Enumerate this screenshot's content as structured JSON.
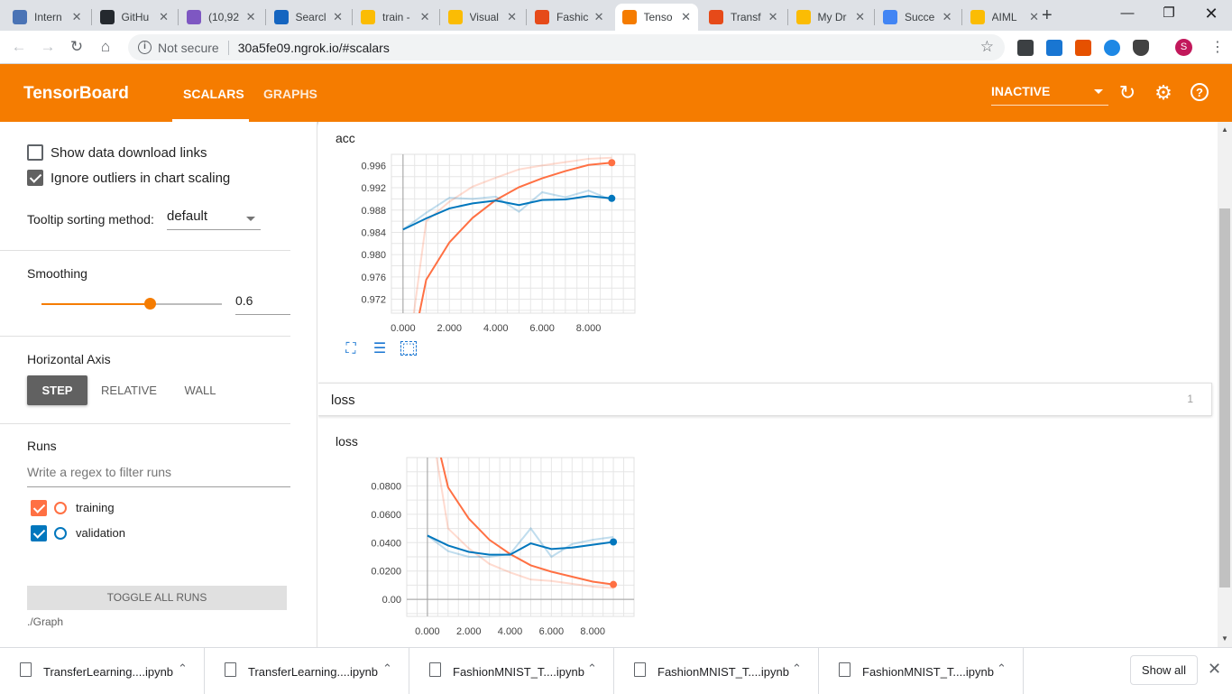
{
  "browser": {
    "tabs": [
      {
        "title": "Intern",
        "color": "#4a73b5"
      },
      {
        "title": "GitHu",
        "color": "#24292e"
      },
      {
        "title": "(10,92",
        "color": "#7e57c2"
      },
      {
        "title": "Searcl",
        "color": "#1565c0"
      },
      {
        "title": "train -",
        "color": "#fbbc04"
      },
      {
        "title": "Visual",
        "color": "#fbbc04"
      },
      {
        "title": "Fashic",
        "color": "#e64a19"
      },
      {
        "title": "Tenso",
        "color": "#f57c00"
      },
      {
        "title": "Transf",
        "color": "#e64a19"
      },
      {
        "title": "My Dr",
        "color": "#fbbc04"
      },
      {
        "title": "Succe",
        "color": "#4285f4"
      },
      {
        "title": "AIML",
        "color": "#fbbc04"
      }
    ],
    "active_tab_index": 7,
    "address": {
      "security": "Not secure",
      "url": "30a5fe09.ngrok.io/#scalars"
    },
    "profile_initial": "S"
  },
  "header": {
    "title": "TensorBoard",
    "tabs": [
      "SCALARS",
      "GRAPHS"
    ],
    "active_tab": "SCALARS",
    "run_state": "INACTIVE",
    "accent": "#f57c00"
  },
  "sidebar": {
    "show_download_links": {
      "label": "Show data download links",
      "checked": false
    },
    "ignore_outliers": {
      "label": "Ignore outliers in chart scaling",
      "checked": true
    },
    "tooltip_label": "Tooltip sorting method:",
    "tooltip_value": "default",
    "smoothing_label": "Smoothing",
    "smoothing_value": "0.6",
    "horizontal_axis_label": "Horizontal Axis",
    "axis_options": [
      "STEP",
      "RELATIVE",
      "WALL"
    ],
    "axis_selected": "STEP",
    "runs_label": "Runs",
    "regex_placeholder": "Write a regex to filter runs",
    "runs": [
      {
        "name": "training",
        "color": "#ff7043",
        "checked": true
      },
      {
        "name": "validation",
        "color": "#0277bd",
        "checked": true
      }
    ],
    "toggle_label": "TOGGLE ALL RUNS",
    "log_dir": "./Graph"
  },
  "main": {
    "loss_category": {
      "name": "loss",
      "count": "1"
    }
  },
  "chart_data": [
    {
      "type": "line",
      "title": "acc",
      "x": [
        0,
        1,
        2,
        3,
        4,
        5,
        6,
        7,
        8,
        9
      ],
      "xticks": [
        "0.000",
        "2.000",
        "4.000",
        "6.000",
        "8.000"
      ],
      "yticks": [
        "0.972",
        "0.976",
        "0.980",
        "0.984",
        "0.988",
        "0.992",
        "0.996"
      ],
      "xlim": [
        -0.5,
        10
      ],
      "ylim": [
        0.9695,
        0.998
      ],
      "series": [
        {
          "name": "training",
          "color": "#ff7043",
          "raw": [
            0.955,
            0.986,
            0.9895,
            0.9922,
            0.9938,
            0.9953,
            0.996,
            0.9966,
            0.9972,
            0.9974
          ],
          "smoothed": [
            0.955,
            0.9755,
            0.9822,
            0.9866,
            0.9898,
            0.9921,
            0.9937,
            0.995,
            0.9961,
            0.9965
          ]
        },
        {
          "name": "validation",
          "color": "#0277bd",
          "raw": [
            0.9845,
            0.9875,
            0.9902,
            0.99,
            0.9904,
            0.9877,
            0.9912,
            0.9903,
            0.9915,
            0.9898
          ],
          "smoothed": [
            0.9845,
            0.9865,
            0.9883,
            0.9892,
            0.9897,
            0.9889,
            0.9898,
            0.9899,
            0.9905,
            0.9901
          ]
        }
      ]
    },
    {
      "type": "line",
      "title": "loss",
      "x": [
        0,
        1,
        2,
        3,
        4,
        5,
        6,
        7,
        8,
        9
      ],
      "xticks": [
        "0.000",
        "2.000",
        "4.000",
        "6.000",
        "8.000"
      ],
      "yticks": [
        "0.00",
        "0.0200",
        "0.0400",
        "0.0600",
        "0.0800"
      ],
      "xlim": [
        -1,
        10
      ],
      "ylim": [
        -0.012,
        0.1
      ],
      "series": [
        {
          "name": "training",
          "color": "#ff7043",
          "raw": [
            0.14,
            0.05,
            0.036,
            0.025,
            0.019,
            0.014,
            0.013,
            0.011,
            0.009,
            0.008
          ],
          "smoothed": [
            0.14,
            0.079,
            0.057,
            0.042,
            0.032,
            0.024,
            0.0195,
            0.016,
            0.0125,
            0.0105
          ]
        },
        {
          "name": "validation",
          "color": "#0277bd",
          "raw": [
            0.045,
            0.034,
            0.03,
            0.03,
            0.032,
            0.05,
            0.03,
            0.039,
            0.042,
            0.044
          ],
          "smoothed": [
            0.045,
            0.038,
            0.0335,
            0.0315,
            0.0315,
            0.0395,
            0.0355,
            0.0365,
            0.0385,
            0.0405
          ]
        }
      ]
    }
  ],
  "downloads": {
    "items": [
      "TransferLearning....ipynb",
      "TransferLearning....ipynb",
      "FashionMNIST_T....ipynb",
      "FashionMNIST_T....ipynb",
      "FashionMNIST_T....ipynb"
    ],
    "show_all": "Show all"
  }
}
